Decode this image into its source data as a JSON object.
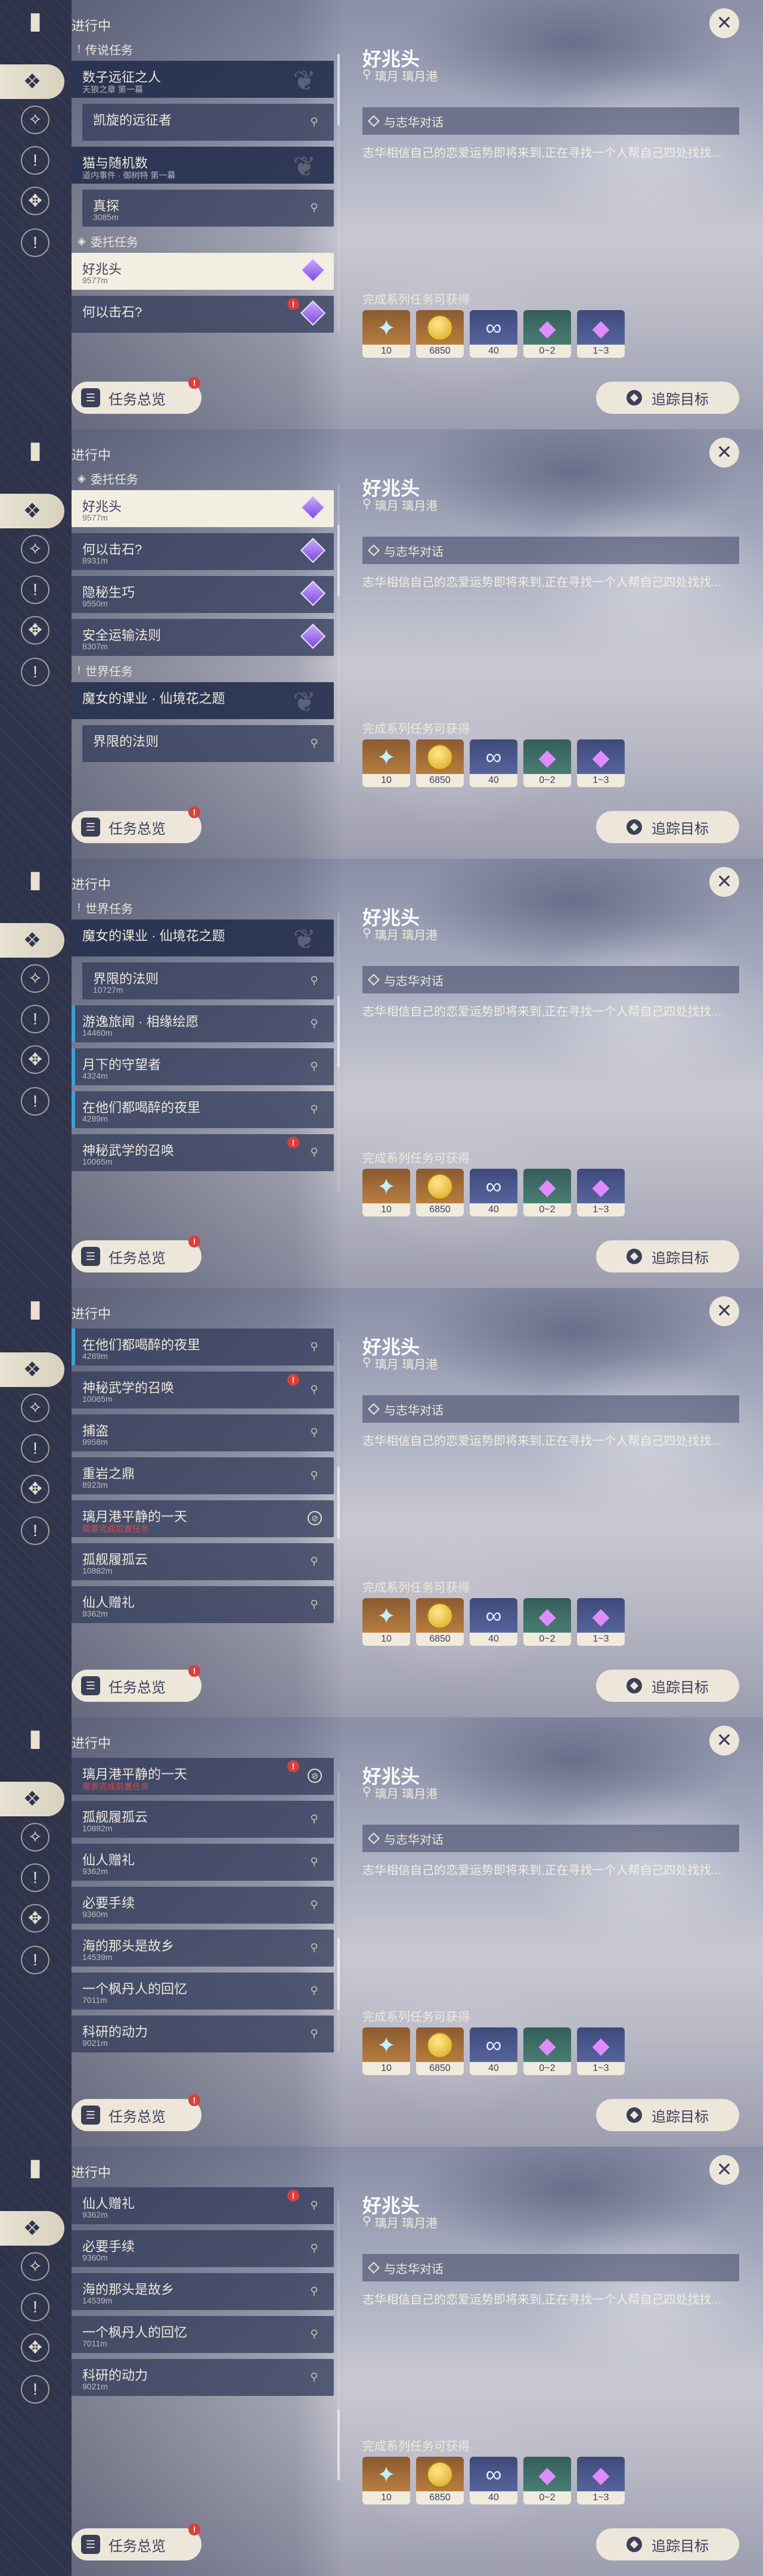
{
  "frames": [
    {
      "header": "进行中",
      "list": [
        {
          "kind": "section",
          "text": "传说任务",
          "marker": "!"
        },
        {
          "kind": "row",
          "style": "top",
          "title": "数子远征之人",
          "detail": "天狼之章 第一幕",
          "icon": "none"
        },
        {
          "kind": "row",
          "style": "child",
          "title": "凯旋的远征者",
          "detail": "",
          "icon": "pin"
        },
        {
          "kind": "row",
          "style": "top",
          "title": "猫与随机数",
          "detail": "道内事件 · 御树特 第一幕",
          "icon": "none"
        },
        {
          "kind": "row",
          "style": "child",
          "title": "真探",
          "detail": "3085m",
          "icon": "pin"
        },
        {
          "kind": "section",
          "text": "委托任务",
          "marker": "◈"
        },
        {
          "kind": "row",
          "style": "sel",
          "title": "好兆头",
          "detail": "9577m",
          "icon": "gem"
        },
        {
          "kind": "row",
          "style": "plain",
          "title": "何以击石?",
          "detail": "",
          "icon": "gem",
          "warn": "!"
        }
      ]
    },
    {
      "header": "进行中",
      "list": [
        {
          "kind": "section",
          "text": "委托任务",
          "marker": "◈"
        },
        {
          "kind": "row",
          "style": "sel",
          "title": "好兆头",
          "detail": "9577m",
          "icon": "gem"
        },
        {
          "kind": "row",
          "style": "plain",
          "title": "何以击石?",
          "detail": "8931m",
          "icon": "gem"
        },
        {
          "kind": "row",
          "style": "plain",
          "title": "隐秘生巧",
          "detail": "9550m",
          "icon": "gem"
        },
        {
          "kind": "row",
          "style": "plain",
          "title": "安全运输法则",
          "detail": "8307m",
          "icon": "gem"
        },
        {
          "kind": "section",
          "text": "世界任务",
          "marker": "!"
        },
        {
          "kind": "row",
          "style": "top",
          "title": "魔女的课业 · 仙境花之题",
          "detail": "",
          "icon": "none"
        },
        {
          "kind": "row",
          "style": "child",
          "title": "界限的法则",
          "detail": "",
          "icon": "pin"
        }
      ]
    },
    {
      "header": "进行中",
      "list": [
        {
          "kind": "section",
          "text": "世界任务",
          "marker": "!"
        },
        {
          "kind": "row",
          "style": "top",
          "title": "魔女的课业 · 仙境花之题",
          "detail": "",
          "icon": "none"
        },
        {
          "kind": "row",
          "style": "child",
          "title": "界限的法则",
          "detail": "10727m",
          "icon": "pin"
        },
        {
          "kind": "row",
          "style": "bar",
          "title": "游逸旅闻 · 相缘绘愿",
          "detail": "14460m",
          "icon": "pin"
        },
        {
          "kind": "row",
          "style": "bar",
          "title": "月下的守望者",
          "detail": "4324m",
          "icon": "pin"
        },
        {
          "kind": "row",
          "style": "bar",
          "title": "在他们都喝醉的夜里",
          "detail": "4289m",
          "icon": "pin"
        },
        {
          "kind": "row",
          "style": "plain",
          "title": "神秘武学的召唤",
          "detail": "10065m",
          "icon": "pin",
          "warn": "!"
        }
      ]
    },
    {
      "header": "进行中",
      "list": [
        {
          "kind": "row",
          "style": "bar",
          "title": "在他们都喝醉的夜里",
          "detail": "4289m",
          "icon": "pin"
        },
        {
          "kind": "row",
          "style": "plain",
          "title": "神秘武学的召唤",
          "detail": "10065m",
          "icon": "pin",
          "warn": "!"
        },
        {
          "kind": "row",
          "style": "plain",
          "title": "捕盗",
          "detail": "9958m",
          "icon": "pin"
        },
        {
          "kind": "row",
          "style": "plain",
          "title": "重岩之鼎",
          "detail": "8923m",
          "icon": "pin"
        },
        {
          "kind": "row",
          "style": "plain",
          "title": "璃月港平静的一天",
          "detail": "需要完成前置任务",
          "detailRed": true,
          "icon": "forbid"
        },
        {
          "kind": "row",
          "style": "plain",
          "title": "孤舰履孤云",
          "detail": "10882m",
          "icon": "pin"
        },
        {
          "kind": "row",
          "style": "plain",
          "title": "仙人赠礼",
          "detail": "9362m",
          "icon": "pin"
        }
      ]
    },
    {
      "header": "进行中",
      "list": [
        {
          "kind": "row",
          "style": "plain",
          "title": "璃月港平静的一天",
          "detail": "需要完成前置任务",
          "detailRed": true,
          "icon": "forbid",
          "warn": "!"
        },
        {
          "kind": "row",
          "style": "plain",
          "title": "孤舰履孤云",
          "detail": "10882m",
          "icon": "pin"
        },
        {
          "kind": "row",
          "style": "plain",
          "title": "仙人赠礼",
          "detail": "9362m",
          "icon": "pin"
        },
        {
          "kind": "row",
          "style": "plain",
          "title": "必要手续",
          "detail": "9360m",
          "icon": "pin"
        },
        {
          "kind": "row",
          "style": "plain",
          "title": "海的那头是故乡",
          "detail": "14539m",
          "icon": "pin"
        },
        {
          "kind": "row",
          "style": "plain",
          "title": "一个枫丹人的回忆",
          "detail": "7011m",
          "icon": "pin"
        },
        {
          "kind": "row",
          "style": "plain",
          "title": "科研的动力",
          "detail": "9021m",
          "icon": "pin"
        }
      ]
    },
    {
      "header": "进行中",
      "list": [
        {
          "kind": "row",
          "style": "plain",
          "title": "仙人赠礼",
          "detail": "9362m",
          "icon": "pin",
          "warn": "!"
        },
        {
          "kind": "row",
          "style": "plain",
          "title": "必要手续",
          "detail": "9360m",
          "icon": "pin"
        },
        {
          "kind": "row",
          "style": "plain",
          "title": "海的那头是故乡",
          "detail": "14539m",
          "icon": "pin"
        },
        {
          "kind": "row",
          "style": "plain",
          "title": "一个枫丹人的回忆",
          "detail": "7011m",
          "icon": "pin"
        },
        {
          "kind": "row",
          "style": "plain",
          "title": "科研的动力",
          "detail": "9021m",
          "icon": "pin"
        }
      ]
    }
  ],
  "overview_label": "任务总览",
  "track_label": "追踪目标",
  "detail": {
    "title": "好兆头",
    "location": "璃月 璃月港",
    "objective": "与志华对话",
    "description": "志华相信自己的恋爱运势即将来到,正在寻找一个人帮自己四处找找...",
    "rewards_label": "完成系列任务可获得"
  },
  "rewards": [
    {
      "name": "primogem",
      "qty": "10",
      "bg": "orange",
      "glyph": "✦"
    },
    {
      "name": "mora",
      "qty": "6850",
      "bg": "orange",
      "glyph": "coin"
    },
    {
      "name": "adventure-exp",
      "qty": "40",
      "bg": "blue",
      "glyph": "∞"
    },
    {
      "name": "ore",
      "qty": "0~2",
      "bg": "green",
      "glyph": "◆"
    },
    {
      "name": "crystal",
      "qty": "1~3",
      "bg": "blue",
      "glyph": "◆"
    }
  ],
  "icons": {
    "rail": [
      "book-icon",
      "quest-diamond-icon",
      "compass-icon",
      "exclaim-icon",
      "ornament-icon",
      "exclaim-icon"
    ],
    "close": "close-icon"
  },
  "colors": {
    "selected": "#f2eee2",
    "accent_bar": "#3aa0d8",
    "warn": "#d7413d"
  }
}
